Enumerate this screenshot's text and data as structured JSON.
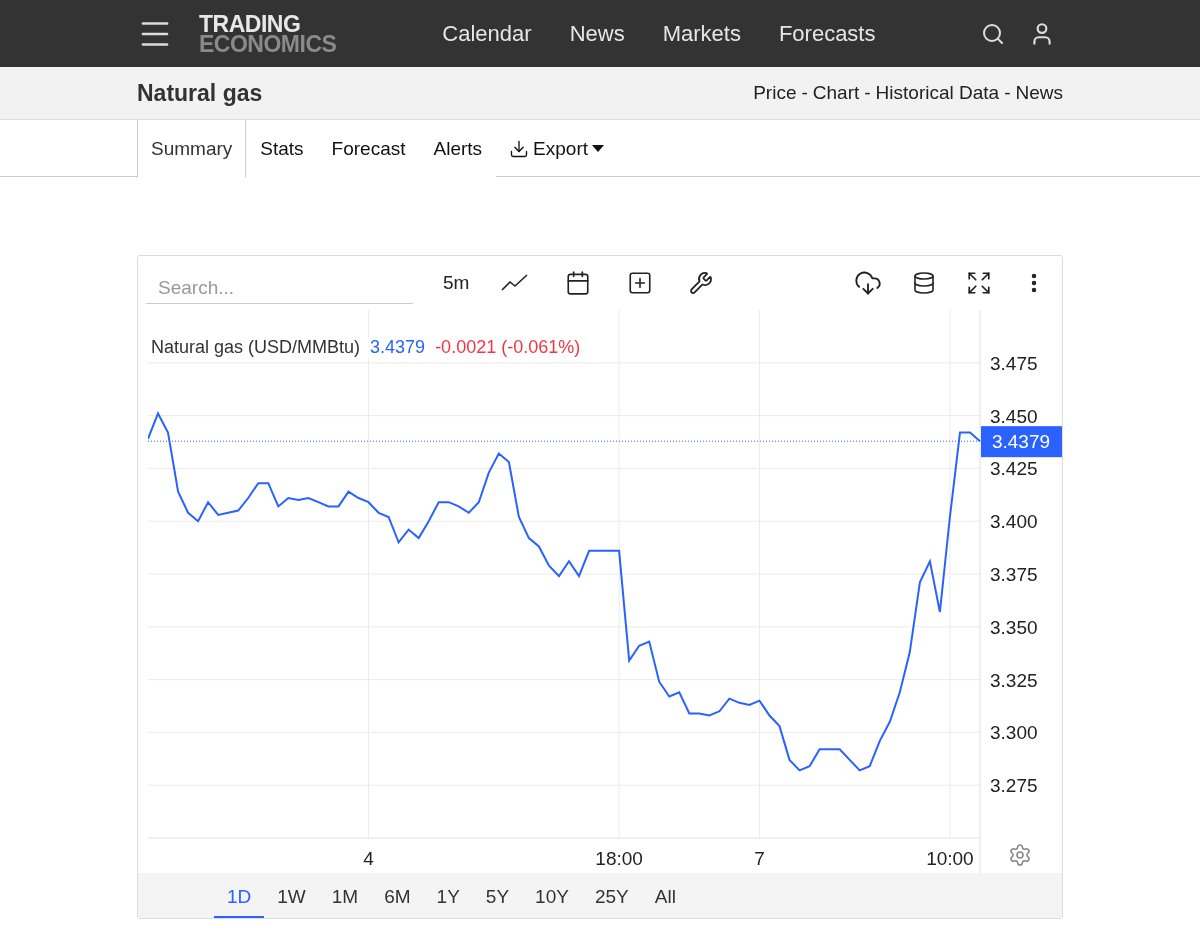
{
  "header": {
    "logo_top": "TRADING",
    "logo_bottom": "ECONOMICS",
    "nav": [
      {
        "label": "Calendar"
      },
      {
        "label": "News"
      },
      {
        "label": "Markets"
      },
      {
        "label": "Forecasts"
      }
    ]
  },
  "title_bar": {
    "title": "Natural gas",
    "links": [
      {
        "text": "Price",
        "separator": "-"
      },
      {
        "text": "Chart",
        "separator": "-"
      },
      {
        "text": "Historical Data",
        "separator": "-"
      },
      {
        "text": "News"
      }
    ]
  },
  "tabs": [
    {
      "label": "Summary",
      "selected": true
    },
    {
      "label": "Stats",
      "selected": false
    },
    {
      "label": "Forecast",
      "selected": false
    },
    {
      "label": "Alerts",
      "selected": false
    }
  ],
  "export": {
    "label": "Export"
  },
  "chart_panel": {
    "search": {
      "placeholder": "Search..."
    },
    "interval": "5m",
    "last_price_label": "3.4379",
    "legend": {
      "price": "3.4379",
      "change": "-0.0021 (-0.061%)"
    },
    "chart_data": {
      "type": "line",
      "categories": [
        null,
        null,
        null,
        null,
        null,
        null,
        null,
        null,
        null,
        null,
        null,
        null,
        null,
        null,
        null,
        null,
        null,
        null,
        null,
        null,
        null,
        null,
        "4",
        null,
        null,
        null,
        null,
        null,
        null,
        null,
        null,
        null,
        null,
        null,
        null,
        null,
        null,
        null,
        null,
        null,
        null,
        null,
        null,
        null,
        null,
        null,
        null,
        "18:00",
        null,
        null,
        null,
        null,
        null,
        null,
        null,
        null,
        null,
        null,
        null,
        null,
        null,
        "7",
        null,
        null,
        null,
        null,
        null,
        null,
        null,
        null,
        null,
        null,
        null,
        null,
        null,
        null,
        null,
        null,
        null,
        null,
        "10:00",
        null,
        null,
        null
      ],
      "series": [
        {
          "name": "Natural gas (USD/MMBtu)",
          "color": "#2962ff",
          "values": [
            3.439,
            3.451,
            3.442,
            3.414,
            3.404,
            3.4,
            3.409,
            3.403,
            3.404,
            3.405,
            3.411,
            3.418,
            3.418,
            3.407,
            3.411,
            3.41,
            3.411,
            3.409,
            3.407,
            3.407,
            3.414,
            3.411,
            3.409,
            3.404,
            3.402,
            3.39,
            3.396,
            3.392,
            3.4,
            3.409,
            3.409,
            3.407,
            3.404,
            3.409,
            3.423,
            3.432,
            3.428,
            3.402,
            3.392,
            3.388,
            3.379,
            3.374,
            3.381,
            3.374,
            3.386,
            3.386,
            3.386,
            3.386,
            3.334,
            3.341,
            3.343,
            3.324,
            3.317,
            3.319,
            3.309,
            3.309,
            3.308,
            3.31,
            3.316,
            3.314,
            3.313,
            3.315,
            3.308,
            3.303,
            3.287,
            3.282,
            3.284,
            3.292,
            3.292,
            3.292,
            3.287,
            3.282,
            3.284,
            3.296,
            3.305,
            3.319,
            3.338,
            3.371,
            3.381,
            3.357,
            3.402,
            3.442,
            3.442,
            3.4379
          ]
        },
        {
          "color": "#2962ff",
          "line_style": "dotted",
          "values": [
            3.4379,
            3.4379,
            3.4379,
            3.4379,
            3.4379,
            3.4379,
            3.4379,
            3.4379,
            3.4379,
            3.4379,
            3.4379,
            3.4379,
            3.4379,
            3.4379,
            3.4379,
            3.4379,
            3.4379,
            3.4379,
            3.4379,
            3.4379,
            3.4379,
            3.4379,
            3.4379,
            3.4379,
            3.4379,
            3.4379,
            3.4379,
            3.4379,
            3.4379,
            3.4379,
            3.4379,
            3.4379,
            3.4379,
            3.4379,
            3.4379,
            3.4379,
            3.4379,
            3.4379,
            3.4379,
            3.4379,
            3.4379,
            3.4379,
            3.4379,
            3.4379,
            3.4379,
            3.4379,
            3.4379,
            3.4379,
            3.4379,
            3.4379,
            3.4379,
            3.4379,
            3.4379,
            3.4379,
            3.4379,
            3.4379,
            3.4379,
            3.4379,
            3.4379,
            3.4379,
            3.4379,
            3.4379,
            3.4379,
            3.4379,
            3.4379,
            3.4379,
            3.4379,
            3.4379,
            3.4379,
            3.4379,
            3.4379,
            3.4379,
            3.4379,
            3.4379,
            3.4379,
            3.4379,
            3.4379,
            3.4379,
            3.4379,
            3.4379,
            3.4379,
            3.4379,
            3.4379,
            3.4379
          ]
        }
      ],
      "ylim": [
        3.25,
        3.5
      ],
      "grid": true,
      "yticks": [
        {
          "value": 3.275,
          "label": "3.275"
        },
        {
          "value": 3.3,
          "label": "3.300"
        },
        {
          "value": 3.325,
          "label": "3.325"
        },
        {
          "value": 3.35,
          "label": "3.350"
        },
        {
          "value": 3.375,
          "label": "3.375"
        },
        {
          "value": 3.4,
          "label": "3.400"
        },
        {
          "value": 3.425,
          "label": "3.425"
        },
        {
          "value": 3.45,
          "label": "3.450"
        },
        {
          "value": 3.475,
          "label": "3.475"
        }
      ]
    },
    "periods": [
      {
        "label": "1D",
        "selected": true
      },
      {
        "label": "1W",
        "selected": false
      },
      {
        "label": "1M",
        "selected": false
      },
      {
        "label": "6M",
        "selected": false
      },
      {
        "label": "1Y",
        "selected": false
      },
      {
        "label": "5Y",
        "selected": false
      },
      {
        "label": "10Y",
        "selected": false
      },
      {
        "label": "25Y",
        "selected": false
      },
      {
        "label": "All",
        "selected": false
      }
    ]
  }
}
